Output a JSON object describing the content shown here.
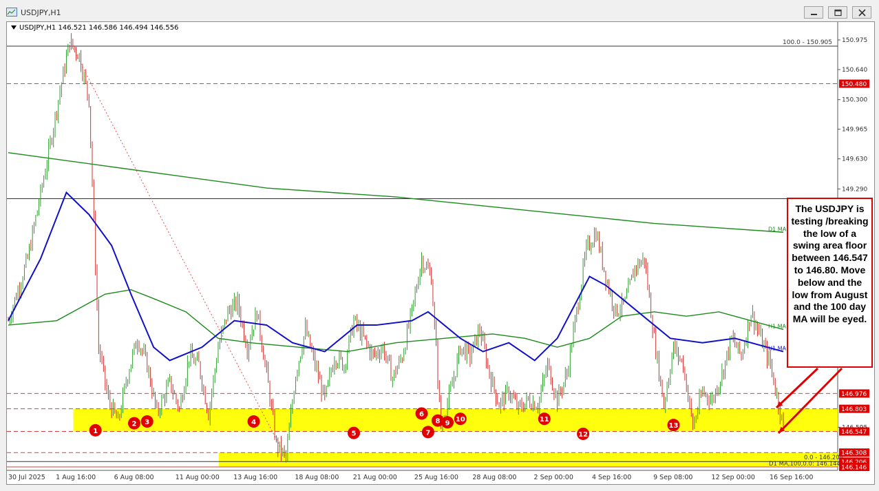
{
  "window": {
    "title": "USDJPY,H1",
    "minimize_icon": "minimize-icon",
    "maximize_icon": "maximize-icon",
    "close_icon": "close-icon"
  },
  "chart_data": {
    "type": "candlestick",
    "symbol_label": "USDJPY,H1  146.521 146.586 146.494 146.556",
    "ohlc_shown": {
      "open": 146.521,
      "high": 146.586,
      "low": 146.494,
      "close": 146.556
    },
    "ylim": [
      146.146,
      150.975
    ],
    "y_tick_labels": [
      "150.975",
      "150.640",
      "150.300",
      "149.965",
      "149.630",
      "149.290",
      "146.595"
    ],
    "x_tick_labels": [
      "30 Jul 2025",
      "1 Aug 16:00",
      "6 Aug 08:00",
      "11 Aug 00:00",
      "13 Aug 16:00",
      "18 Aug 08:00",
      "21 Aug 00:00",
      "25 Aug 16:00",
      "28 Aug 08:00",
      "2 Sep 00:00",
      "4 Sep 16:00",
      "9 Sep 08:00",
      "12 Sep 00:00",
      "16 Sep 16:00"
    ],
    "price_path": [
      [
        0,
        147.8
      ],
      [
        6,
        148.5
      ],
      [
        12,
        149.6
      ],
      [
        16,
        150.4
      ],
      [
        19,
        150.95
      ],
      [
        22,
        150.8
      ],
      [
        25,
        150.3
      ],
      [
        28,
        147.5
      ],
      [
        31,
        146.9
      ],
      [
        34,
        146.65
      ],
      [
        37,
        147.2
      ],
      [
        40,
        147.6
      ],
      [
        43,
        147.3
      ],
      [
        46,
        146.75
      ],
      [
        50,
        147.1
      ],
      [
        53,
        146.8
      ],
      [
        56,
        147.4
      ],
      [
        59,
        147.3
      ],
      [
        62,
        146.75
      ],
      [
        65,
        147.5
      ],
      [
        68,
        147.9
      ],
      [
        71,
        148.0
      ],
      [
        74,
        147.5
      ],
      [
        77,
        147.9
      ],
      [
        80,
        147.2
      ],
      [
        83,
        146.4
      ],
      [
        86,
        146.25
      ],
      [
        89,
        147.2
      ],
      [
        92,
        147.7
      ],
      [
        95,
        147.3
      ],
      [
        98,
        146.9
      ],
      [
        101,
        147.4
      ],
      [
        104,
        147.3
      ],
      [
        107,
        147.8
      ],
      [
        110,
        147.6
      ],
      [
        113,
        147.4
      ],
      [
        116,
        147.5
      ],
      [
        119,
        147.15
      ],
      [
        122,
        147.4
      ],
      [
        125,
        147.9
      ],
      [
        128,
        148.5
      ],
      [
        131,
        148.3
      ],
      [
        134,
        146.6
      ],
      [
        137,
        147.0
      ],
      [
        140,
        147.5
      ],
      [
        143,
        147.4
      ],
      [
        146,
        147.7
      ],
      [
        149,
        147.2
      ],
      [
        152,
        146.85
      ],
      [
        155,
        147.0
      ],
      [
        158,
        146.8
      ],
      [
        161,
        146.9
      ],
      [
        164,
        146.85
      ],
      [
        167,
        147.3
      ],
      [
        170,
        146.9
      ],
      [
        173,
        147.2
      ],
      [
        176,
        147.9
      ],
      [
        179,
        148.6
      ],
      [
        182,
        148.8
      ],
      [
        185,
        148.3
      ],
      [
        188,
        147.9
      ],
      [
        191,
        148.0
      ],
      [
        194,
        148.4
      ],
      [
        197,
        148.5
      ],
      [
        200,
        147.6
      ],
      [
        203,
        146.85
      ],
      [
        206,
        147.5
      ],
      [
        209,
        147.3
      ],
      [
        212,
        146.6
      ],
      [
        215,
        147.0
      ],
      [
        218,
        146.9
      ],
      [
        221,
        147.2
      ],
      [
        224,
        147.6
      ],
      [
        227,
        147.4
      ],
      [
        230,
        147.9
      ],
      [
        233,
        147.6
      ],
      [
        236,
        147.3
      ],
      [
        240,
        146.6
      ]
    ],
    "overlays": [
      {
        "name": "D1 MA",
        "color": "#1a8a1a",
        "label": "D1 MA",
        "path": [
          [
            0,
            149.7
          ],
          [
            40,
            149.5
          ],
          [
            80,
            149.3
          ],
          [
            120,
            149.2
          ],
          [
            160,
            149.05
          ],
          [
            200,
            148.9
          ],
          [
            240,
            148.8
          ]
        ]
      },
      {
        "name": "H1 MA",
        "color": "#1a8a1a",
        "label": "H1 MA",
        "path": [
          [
            0,
            147.75
          ],
          [
            15,
            147.8
          ],
          [
            30,
            148.1
          ],
          [
            38,
            148.15
          ],
          [
            45,
            148.05
          ],
          [
            55,
            147.9
          ],
          [
            65,
            147.6
          ],
          [
            75,
            147.55
          ],
          [
            90,
            147.5
          ],
          [
            105,
            147.45
          ],
          [
            120,
            147.55
          ],
          [
            135,
            147.6
          ],
          [
            150,
            147.65
          ],
          [
            160,
            147.6
          ],
          [
            170,
            147.5
          ],
          [
            180,
            147.6
          ],
          [
            190,
            147.85
          ],
          [
            200,
            147.9
          ],
          [
            210,
            147.85
          ],
          [
            220,
            147.9
          ],
          [
            230,
            147.8
          ],
          [
            240,
            147.7
          ]
        ]
      },
      {
        "name": "H1 MA",
        "color": "#1010c8",
        "label": "H1 MA",
        "path": [
          [
            0,
            147.8
          ],
          [
            10,
            148.5
          ],
          [
            18,
            149.25
          ],
          [
            25,
            149.0
          ],
          [
            32,
            148.65
          ],
          [
            38,
            148.1
          ],
          [
            45,
            147.5
          ],
          [
            50,
            147.35
          ],
          [
            60,
            147.5
          ],
          [
            70,
            147.8
          ],
          [
            80,
            147.75
          ],
          [
            88,
            147.55
          ],
          [
            98,
            147.45
          ],
          [
            108,
            147.75
          ],
          [
            114,
            147.75
          ],
          [
            125,
            147.8
          ],
          [
            130,
            147.9
          ],
          [
            140,
            147.6
          ],
          [
            147,
            147.45
          ],
          [
            155,
            147.55
          ],
          [
            163,
            147.35
          ],
          [
            170,
            147.6
          ],
          [
            175,
            147.95
          ],
          [
            180,
            148.3
          ],
          [
            185,
            148.2
          ],
          [
            195,
            147.9
          ],
          [
            205,
            147.6
          ],
          [
            215,
            147.55
          ],
          [
            225,
            147.6
          ],
          [
            240,
            147.45
          ]
        ]
      }
    ],
    "horizontal_levels": [
      {
        "price": 150.905,
        "label": "100.0 - 150.905",
        "style": "solid",
        "color": "#333333"
      },
      {
        "price": 150.48,
        "label": "150.480",
        "style": "dashed",
        "color": "#d04040"
      },
      {
        "price": 149.18,
        "label": "",
        "style": "solid",
        "color": "#333333"
      },
      {
        "price": 146.976,
        "label": "146.976",
        "style": "dashed",
        "color": "#d04040"
      },
      {
        "price": 146.803,
        "label": "146.803",
        "style": "dashed",
        "color": "#d04040"
      },
      {
        "price": 146.547,
        "label": "146.547",
        "style": "dashed",
        "color": "#d04040"
      },
      {
        "price": 146.308,
        "label": "146.308",
        "style": "dashed",
        "color": "#d04040"
      },
      {
        "price": 146.206,
        "label": "146.206",
        "style": "solid",
        "color": "#333333"
      },
      {
        "price": 146.146,
        "label": "146.146",
        "style": "solid",
        "color": "#d04040"
      }
    ],
    "price_badges": [
      {
        "price": 150.48,
        "label": "150.480"
      },
      {
        "price": 146.976,
        "label": "146.976"
      },
      {
        "price": 146.803,
        "label": "146.803"
      },
      {
        "price": 146.547,
        "label": "146.547"
      },
      {
        "price": 146.308,
        "label": "146.308"
      },
      {
        "price": 146.206,
        "label": "146.206"
      },
      {
        "price": 146.146,
        "label": "146.146"
      }
    ],
    "zones": [
      {
        "x0": 0.08,
        "x1": 1.0,
        "y0": 146.547,
        "y1": 146.803,
        "color": "#ffff00"
      },
      {
        "x0": 0.255,
        "x1": 1.0,
        "y0": 146.146,
        "y1": 146.308,
        "color": "#ffff00"
      }
    ],
    "fib_labels": [
      {
        "text": "0.0 - 146.204"
      },
      {
        "text": "D1 MA,100,0.0: 146.144"
      }
    ],
    "markers": [
      {
        "label": "1"
      },
      {
        "label": "2"
      },
      {
        "label": "3"
      },
      {
        "label": "4"
      },
      {
        "label": "5"
      },
      {
        "label": "6"
      },
      {
        "label": "7"
      },
      {
        "label": "8"
      },
      {
        "label": "9"
      },
      {
        "label": "10"
      },
      {
        "label": "11"
      },
      {
        "label": "12"
      },
      {
        "label": "13"
      }
    ],
    "annotation": "The USDJPY is testing /breaking the low of a swing area floor between 146.547 to 146.80.  Move below and the low from August and the 100 day MA will be eyed."
  }
}
